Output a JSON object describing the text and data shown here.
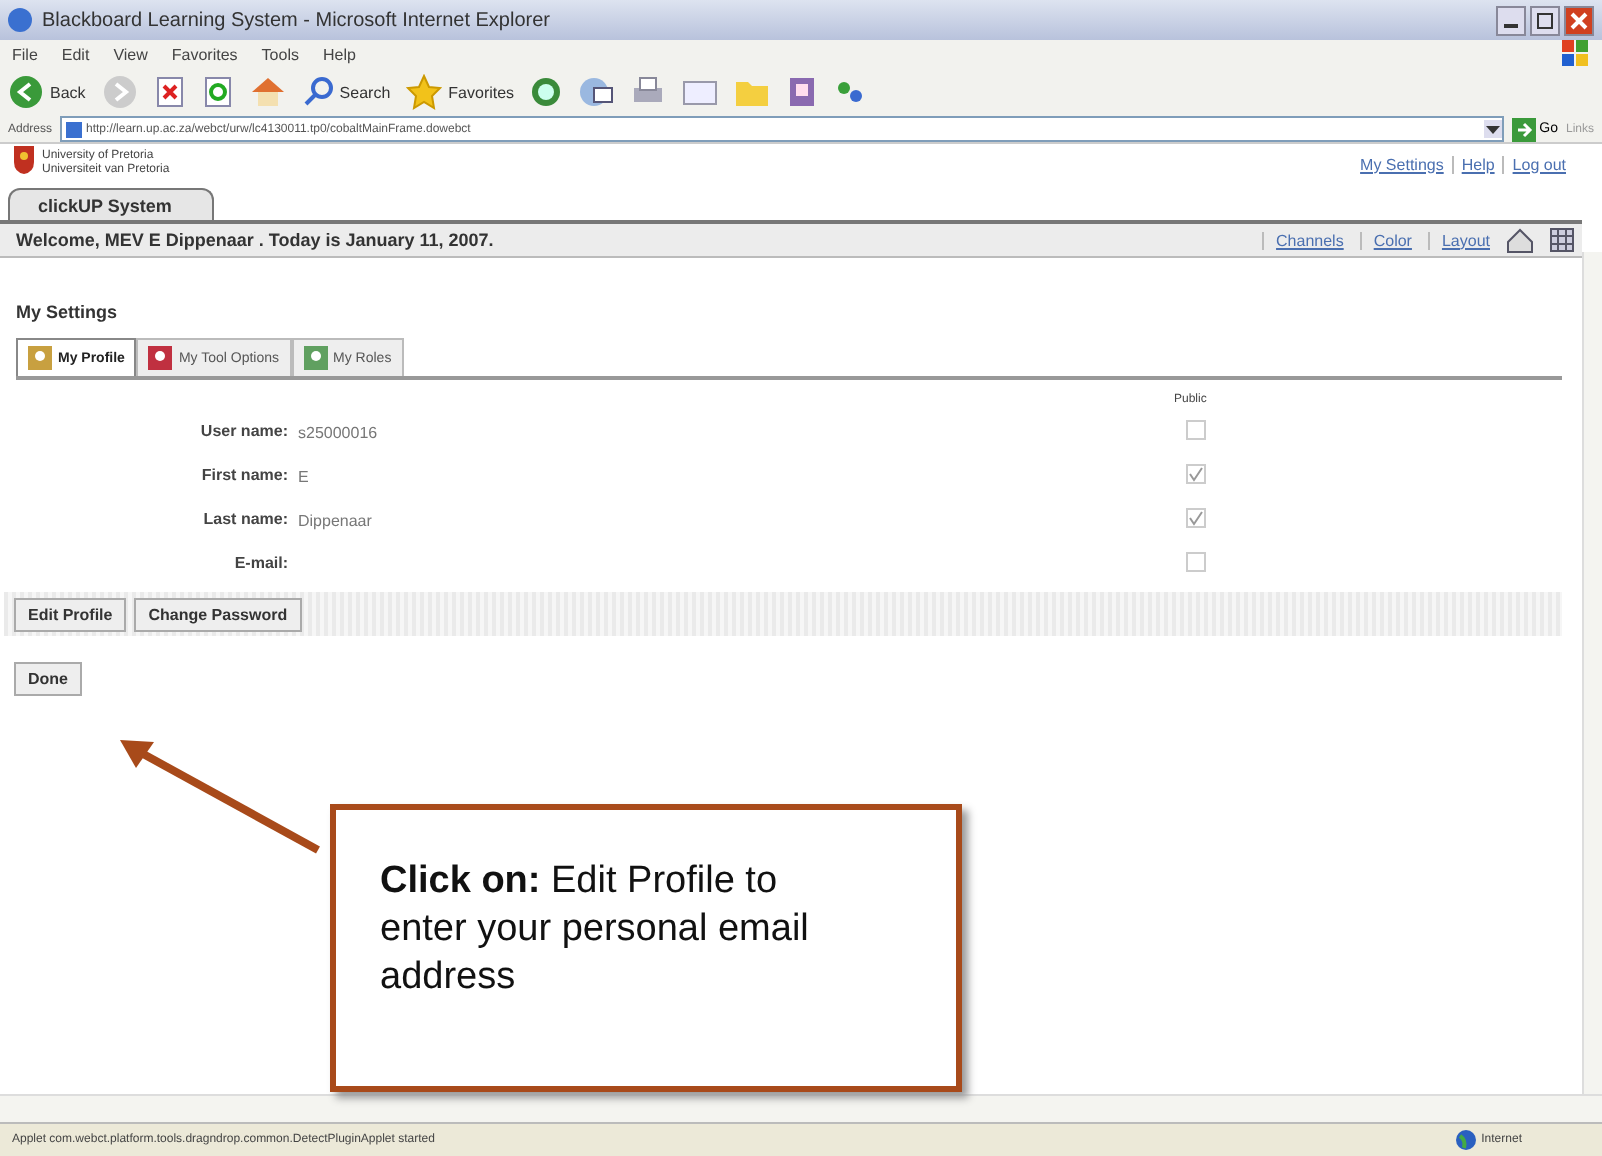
{
  "window": {
    "title": "Blackboard Learning System - Microsoft Internet Explorer"
  },
  "menu": [
    "File",
    "Edit",
    "View",
    "Favorites",
    "Tools",
    "Help"
  ],
  "toolbar": {
    "back": "Back",
    "search": "Search",
    "favorites": "Favorites"
  },
  "address": {
    "label": "Address",
    "url": "http://learn.up.ac.za/webct/urw/lc4130011.tp0/cobaltMainFrame.dowebct",
    "go": "Go",
    "links": "Links"
  },
  "header": {
    "university": [
      "University of Pretoria",
      "Universiteit van Pretoria"
    ],
    "links": [
      "My Settings",
      "Help",
      "Log out"
    ],
    "tab": "clickUP System"
  },
  "welcome": {
    "text": "Welcome, MEV E Dippenaar . Today is January 11, 2007.",
    "links": [
      "Channels",
      "Color",
      "Layout"
    ]
  },
  "settings": {
    "heading": "My Settings",
    "tabs": [
      {
        "label": "My Profile",
        "selected": true
      },
      {
        "label": "My Tool Options",
        "selected": false
      },
      {
        "label": "My Roles",
        "selected": false
      }
    ],
    "public_header": "Public",
    "fields": [
      {
        "label": "User name:",
        "value": "s25000016",
        "public": false
      },
      {
        "label": "First name:",
        "value": "E",
        "public": true
      },
      {
        "label": "Last name:",
        "value": "Dippenaar",
        "public": true
      },
      {
        "label": "E-mail:",
        "public": false
      }
    ],
    "buttons": [
      "Edit Profile",
      "Change Password"
    ],
    "done": "Done"
  },
  "callout": {
    "text": "**Click on:** Edit Profile to enter your personal email address"
  },
  "status_bar": {
    "text": "Applet com.webct.platform.tools.dragndrop.common.DetectPluginApplet started",
    "zone": "Internet"
  }
}
